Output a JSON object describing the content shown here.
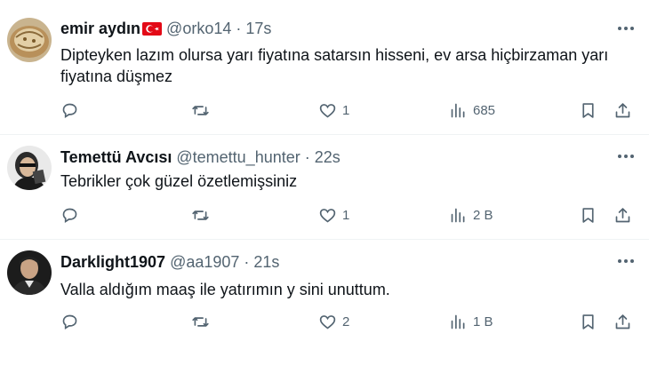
{
  "tweets": [
    {
      "name": "emir aydın",
      "has_flag": true,
      "handle": "@orko14",
      "separator": "·",
      "time": "17s",
      "text": "Dipteyken lazım olursa yarı fiyatına satarsın hisseni, ev arsa hiçbirzaman yarı fiyatına düşmez",
      "likes": "1",
      "views": "685"
    },
    {
      "name": "Temettü Avcısı",
      "has_flag": false,
      "handle": "@temettu_hunter",
      "separator": "·",
      "time": "22s",
      "text": "Tebrikler çok güzel özetlemişsiniz",
      "likes": "1",
      "views": "2 B"
    },
    {
      "name": "Darklight1907",
      "has_flag": false,
      "handle": "@aa1907",
      "separator": "·",
      "time": "21s",
      "text": "Valla aldığım maaş ile yatırımın y sini unuttum.",
      "likes": "2",
      "views": "1 B"
    }
  ],
  "colors": {
    "text": "#0f1419",
    "secondary": "#536471",
    "divider": "#eff3f4",
    "flag_red": "#e30a17"
  }
}
